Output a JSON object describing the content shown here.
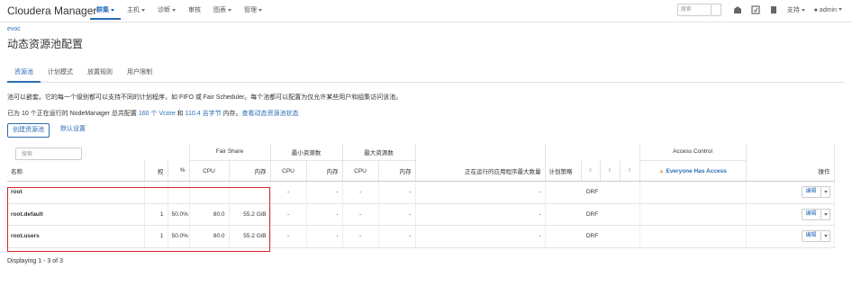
{
  "header": {
    "brand": "Cloudera Manager",
    "nav": [
      {
        "label": "群集",
        "active": true,
        "dropdown": true
      },
      {
        "label": "主机",
        "active": false,
        "dropdown": true
      },
      {
        "label": "诊断",
        "active": false,
        "dropdown": true
      },
      {
        "label": "审核",
        "active": false,
        "dropdown": false
      },
      {
        "label": "图表",
        "active": false,
        "dropdown": true
      },
      {
        "label": "管理",
        "active": false,
        "dropdown": true
      }
    ],
    "search_placeholder": "搜索",
    "support_label": "支持",
    "user_label": "admin"
  },
  "breadcrumb": "evoc",
  "page_title": "动态资源池配置",
  "tabs": [
    {
      "label": "资源池",
      "active": true
    },
    {
      "label": "计划模式",
      "active": false
    },
    {
      "label": "放置规则",
      "active": false
    },
    {
      "label": "用户限制",
      "active": false
    }
  ],
  "description": "池可以嵌套。它的每一个级别都可以支持不同的计划程序，如 FIFO 或 Fair Scheduler。每个池都可以配置为仅允许某些用户和组集访问该池。",
  "capacity": {
    "prefix": "已为 10 个正在运行的 NodeManager 总共配置 ",
    "vcore": "160 个 Vcore",
    "and": " 和 ",
    "memory": "110.4 吉字节",
    "suffix": " 内存。",
    "link": "查看动态资源池状态"
  },
  "buttons": {
    "create": "创建资源池",
    "default": "默认设置"
  },
  "table": {
    "search_placeholder": "搜索",
    "group_headers": {
      "fair_share": "Fair Share",
      "min_resources": "最小资源数",
      "max_resources": "最大资源数",
      "access_control": "Access Control"
    },
    "columns": {
      "name": "名称",
      "weight": "权",
      "percent": "%",
      "cpu": "CPU",
      "memory": "内存",
      "max_running_apps": "正在运行的应用程序最大数量",
      "policy": "计划策略",
      "everyone": "Everyone Has Access",
      "actions": "操作"
    },
    "rows": [
      {
        "name": "root",
        "weight": "",
        "percent": "",
        "cpu": "",
        "memory": "",
        "min_cpu": "-",
        "min_mem": "-",
        "max_cpu": "-",
        "max_mem": "-",
        "max_apps": "-",
        "policy": "DRF",
        "edit": "编辑"
      },
      {
        "name": "root.default",
        "weight": "1",
        "percent": "50.0%",
        "cpu": "80.0",
        "memory": "55.2 GiB",
        "min_cpu": "-",
        "min_mem": "-",
        "max_cpu": "-",
        "max_mem": "-",
        "max_apps": "-",
        "policy": "DRF",
        "edit": "编辑"
      },
      {
        "name": "root.users",
        "weight": "1",
        "percent": "50.0%",
        "cpu": "80.0",
        "memory": "55.2 GiB",
        "min_cpu": "-",
        "min_mem": "-",
        "max_cpu": "-",
        "max_mem": "-",
        "max_apps": "-",
        "policy": "DRF",
        "edit": "编辑"
      }
    ]
  },
  "footer": "Displaying 1 - 3 of 3",
  "colors": {
    "accent": "#2a6db5",
    "highlight": "#d9262c",
    "warning": "#f0ad4e"
  }
}
